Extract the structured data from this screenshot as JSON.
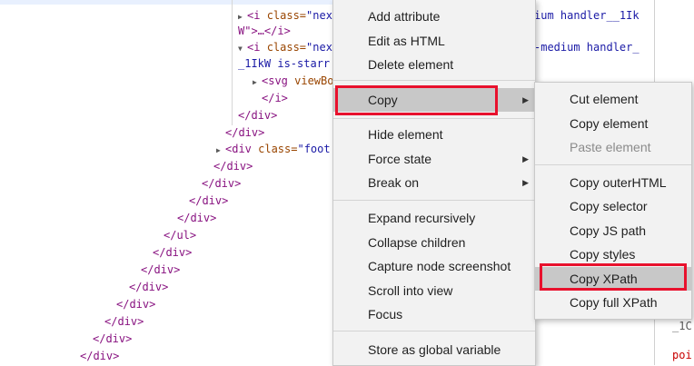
{
  "dom": {
    "line1": {
      "tag_open": "<i ",
      "attr": "class=",
      "val": "\"nex",
      "cont": "W\">…</i>",
      "right": "ium handler__1Ik"
    },
    "line2": {
      "tag_open": "<i ",
      "attr": "class=",
      "val": "\"nex",
      "cont": "_1IkW is-starr",
      "right": "-medium handler_"
    },
    "svg": {
      "tag": "<svg ",
      "attr": "viewBo"
    },
    "close_i": "</i>",
    "close_div": "</div>",
    "close_ul": "</ul>",
    "foot": {
      "tag": "<div ",
      "attr": "class=",
      "val": "\"foot"
    },
    "side_frag1": "_1C",
    "side_frag2": "poi"
  },
  "menu_main": {
    "items": [
      "Add attribute",
      "Edit as HTML",
      "Delete element",
      "Copy",
      "Hide element",
      "Force state",
      "Break on",
      "Expand recursively",
      "Collapse children",
      "Capture node screenshot",
      "Scroll into view",
      "Focus",
      "Store as global variable"
    ]
  },
  "menu_copy": {
    "items": [
      "Cut element",
      "Copy element",
      "Paste element",
      "Copy outerHTML",
      "Copy selector",
      "Copy JS path",
      "Copy styles",
      "Copy XPath",
      "Copy full XPath"
    ]
  },
  "colors": {
    "highlight_border": "#e8112d",
    "tag": "#881280",
    "attr": "#994500",
    "value": "#1a1aa6"
  }
}
